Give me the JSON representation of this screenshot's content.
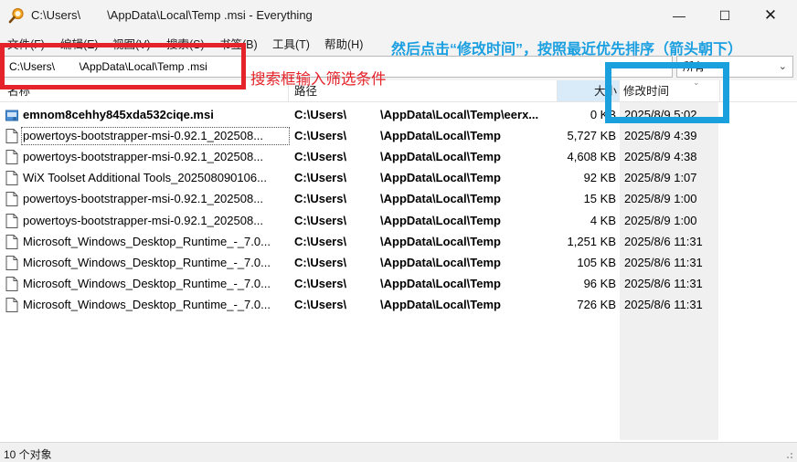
{
  "window": {
    "title": "C:\\Users\\        \\AppData\\Local\\Temp .msi - Everything",
    "minimize": "—",
    "maximize": "☐",
    "close": "✕"
  },
  "menu": {
    "items": [
      "文件(F)",
      "编辑(E)",
      "视图(V)",
      "搜索(S)",
      "书签(B)",
      "工具(T)",
      "帮助(H)"
    ]
  },
  "search": {
    "value": "C:\\Users\\        \\AppData\\Local\\Temp .msi",
    "filter": "所有"
  },
  "columns": {
    "name": "名称",
    "path": "路径",
    "size": "大小",
    "date": "修改时间"
  },
  "rows": [
    {
      "icon": "installer-icon",
      "name": "emnom8cehhy845xda532ciqe.msi",
      "bold": true,
      "path_root": "C:\\Users\\",
      "path_rest": "\\AppData\\Local\\Temp\\eerx...",
      "size": "0 KB",
      "date": "2025/8/9 5:02"
    },
    {
      "icon": "document-icon",
      "name": "powertoys-bootstrapper-msi-0.92.1_202508...",
      "bold": false,
      "path_root": "C:\\Users\\",
      "path_rest": "\\AppData\\Local\\Temp",
      "size": "5,727 KB",
      "date": "2025/8/9 4:39"
    },
    {
      "icon": "document-icon",
      "name": "powertoys-bootstrapper-msi-0.92.1_202508...",
      "bold": false,
      "path_root": "C:\\Users\\",
      "path_rest": "\\AppData\\Local\\Temp",
      "size": "4,608 KB",
      "date": "2025/8/9 4:38"
    },
    {
      "icon": "document-icon",
      "name": "WiX Toolset Additional Tools_202508090106...",
      "bold": false,
      "path_root": "C:\\Users\\",
      "path_rest": "\\AppData\\Local\\Temp",
      "size": "92 KB",
      "date": "2025/8/9 1:07"
    },
    {
      "icon": "document-icon",
      "name": "powertoys-bootstrapper-msi-0.92.1_202508...",
      "bold": false,
      "path_root": "C:\\Users\\",
      "path_rest": "\\AppData\\Local\\Temp",
      "size": "15 KB",
      "date": "2025/8/9 1:00"
    },
    {
      "icon": "document-icon",
      "name": "powertoys-bootstrapper-msi-0.92.1_202508...",
      "bold": false,
      "path_root": "C:\\Users\\",
      "path_rest": "\\AppData\\Local\\Temp",
      "size": "4 KB",
      "date": "2025/8/9 1:00"
    },
    {
      "icon": "document-icon",
      "name": "Microsoft_Windows_Desktop_Runtime_-_7.0...",
      "bold": false,
      "path_root": "C:\\Users\\",
      "path_rest": "\\AppData\\Local\\Temp",
      "size": "1,251 KB",
      "date": "2025/8/6 11:31"
    },
    {
      "icon": "document-icon",
      "name": "Microsoft_Windows_Desktop_Runtime_-_7.0...",
      "bold": false,
      "path_root": "C:\\Users\\",
      "path_rest": "\\AppData\\Local\\Temp",
      "size": "105 KB",
      "date": "2025/8/6 11:31"
    },
    {
      "icon": "document-icon",
      "name": "Microsoft_Windows_Desktop_Runtime_-_7.0...",
      "bold": false,
      "path_root": "C:\\Users\\",
      "path_rest": "\\AppData\\Local\\Temp",
      "size": "96 KB",
      "date": "2025/8/6 11:31"
    },
    {
      "icon": "document-icon",
      "name": "Microsoft_Windows_Desktop_Runtime_-_7.0...",
      "bold": false,
      "path_root": "C:\\Users\\",
      "path_rest": "\\AppData\\Local\\Temp",
      "size": "726 KB",
      "date": "2025/8/6 11:31"
    }
  ],
  "status": {
    "text": "10 个对象"
  },
  "annotations": {
    "red_text": "搜索框输入筛选条件",
    "blue_text": "然后点击“修改时间”，按照最近优先排序（箭头朝下）",
    "red_color": "#e5232a",
    "blue_color": "#1aa0dc"
  }
}
